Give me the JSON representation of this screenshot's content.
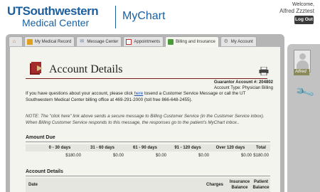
{
  "header": {
    "logo_top_ut": "UT",
    "logo_top_rest": "Southwestern",
    "logo_bottom": "Medical Center",
    "app_name": "MyChart",
    "welcome_label": "Welcome,",
    "user_name": "Alfred Zzztest",
    "logout_label": "Log Out"
  },
  "tabs": [
    {
      "label": "",
      "icon": "home-icon"
    },
    {
      "label": "My Medical Record",
      "icon": "folder-icon"
    },
    {
      "label": "Message Center",
      "icon": "envelope-icon"
    },
    {
      "label": "Appointments",
      "icon": "calendar-icon"
    },
    {
      "label": "Billing and Insurance",
      "icon": "money-icon",
      "active": true
    },
    {
      "label": "My Account",
      "icon": "gear-icon"
    }
  ],
  "side": {
    "avatar_label": "Alfred"
  },
  "page": {
    "title": "Account Details",
    "guarantor_label": "Guarantor Account #:",
    "guarantor_value": "204802",
    "account_type_label": "Account Type:",
    "account_type_value": "Physician Billing",
    "para_pre": "If you have questions about your account, please click",
    "para_link": "here",
    "para_post": "tosend a Customer Service Message or call the UT Southwestern Medical Center billing office at 469-291-2000 (toll free 866-648-2455).",
    "note": "NOTE: The \"click here\" link above sends a secure message to Billing Customer Service (in the Customer Service inbox). When Billing Customer Service responds to this message, the responses go to the patient's MyChart inbox.."
  },
  "amount_due": {
    "heading": "Amount Due",
    "columns": [
      "0 - 30 days",
      "31 - 60 days",
      "61 - 90 days",
      "91 - 120 days",
      "Over 120 days",
      "Total"
    ],
    "values": [
      "$180.00",
      "$0.00",
      "$0.00",
      "$0.00",
      "$0.00",
      "$180.00"
    ]
  },
  "account_details": {
    "heading": "Account Details",
    "col_date": "Date",
    "col_charges": "Charges",
    "col_insurance_1": "Insurance",
    "col_insurance_2": "Balance",
    "col_patient_1": "Patient",
    "col_patient_2": "Balance"
  },
  "colors": {
    "brand": "#1b5f9e",
    "accent_line": "#7a1c1c",
    "link": "#1b4fb5"
  }
}
